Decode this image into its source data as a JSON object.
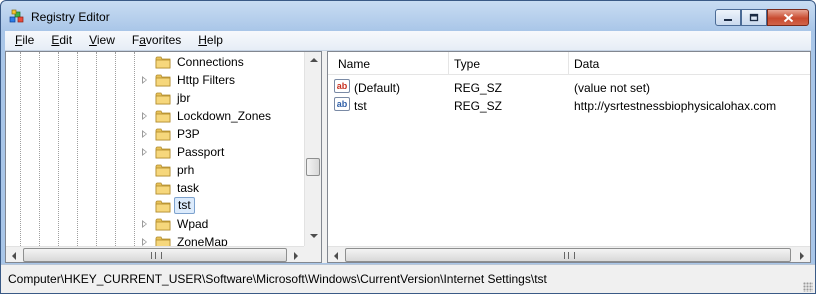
{
  "window": {
    "title": "Registry Editor"
  },
  "menu": [
    {
      "accel": "F",
      "rest": "ile"
    },
    {
      "accel": "E",
      "rest": "dit"
    },
    {
      "accel": "V",
      "rest": "iew"
    },
    {
      "accel": "",
      "pre": "F",
      "accel2": "a",
      "rest": "vorites"
    },
    {
      "accel": "H",
      "rest": "elp"
    }
  ],
  "menu_labels": [
    "File",
    "Edit",
    "View",
    "Favorites",
    "Help"
  ],
  "tree": {
    "items": [
      {
        "label": "Connections",
        "expandable": false
      },
      {
        "label": "Http Filters",
        "expandable": true
      },
      {
        "label": "jbr",
        "expandable": false
      },
      {
        "label": "Lockdown_Zones",
        "expandable": true
      },
      {
        "label": "P3P",
        "expandable": true
      },
      {
        "label": "Passport",
        "expandable": true
      },
      {
        "label": "prh",
        "expandable": false
      },
      {
        "label": "task",
        "expandable": false
      },
      {
        "label": "tst",
        "expandable": false,
        "selected": true
      },
      {
        "label": "Wpad",
        "expandable": true
      },
      {
        "label": "ZoneMap",
        "expandable": true
      }
    ]
  },
  "list": {
    "columns": [
      "Name",
      "Type",
      "Data"
    ],
    "rows": [
      {
        "name": "(Default)",
        "type": "REG_SZ",
        "data": "(value not set)",
        "icon": "string-value-icon"
      },
      {
        "name": "tst",
        "type": "REG_SZ",
        "data": "http://ysrtestnessbiophysicalohax.com",
        "icon": "string-value-icon"
      }
    ]
  },
  "status": {
    "path": "Computer\\HKEY_CURRENT_USER\\Software\\Microsoft\\Windows\\CurrentVersion\\Internet Settings\\tst"
  },
  "colors": {
    "titlebar": "#a9c6e8",
    "selection": "#dcebfc",
    "close_button": "#c84a2f"
  }
}
